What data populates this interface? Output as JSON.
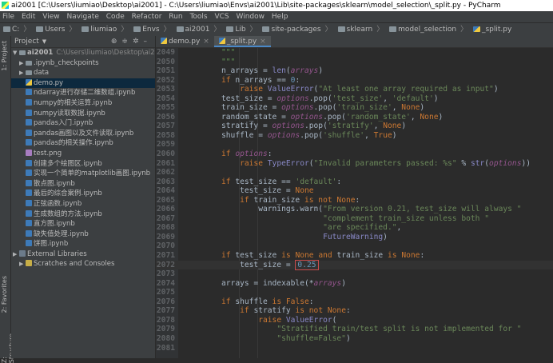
{
  "window": {
    "title": "ai2001 [C:\\Users\\liumiao\\Desktop\\ai2001] - C:\\Users\\liumiao\\Envs\\ai2001\\Lib\\site-packages\\sklearn\\model_selection\\_split.py - PyCharm"
  },
  "menu": [
    "File",
    "Edit",
    "View",
    "Navigate",
    "Code",
    "Refactor",
    "Run",
    "Tools",
    "VCS",
    "Window",
    "Help"
  ],
  "breadcrumbs": [
    "C:",
    "Users",
    "liumiao",
    "Envs",
    "ai2001",
    "Lib",
    "site-packages",
    "sklearn",
    "model_selection",
    "_split.py"
  ],
  "left_tools": {
    "project": "1: Project",
    "favorites": "2: Favorites",
    "structure": "Z: Structure"
  },
  "project_panel": {
    "title": "Project",
    "root": {
      "name": "ai2001",
      "path": "C:\\Users\\liumiao\\Desktop\\ai2001"
    },
    "items": [
      {
        "name": ".ipynb_checkpoints",
        "type": "folder"
      },
      {
        "name": "data",
        "type": "folder"
      },
      {
        "name": "demo.py",
        "type": "py",
        "selected": true
      },
      {
        "name": "ndarray进行存储二维数组.ipynb",
        "type": "nb"
      },
      {
        "name": "numpy的相关运算.ipynb",
        "type": "nb"
      },
      {
        "name": "numpy读取数据.ipynb",
        "type": "nb"
      },
      {
        "name": "pandas入门.ipynb",
        "type": "nb"
      },
      {
        "name": "pandas画图以及文件读取.ipynb",
        "type": "nb"
      },
      {
        "name": "pandas的相关操作.ipynb",
        "type": "nb"
      },
      {
        "name": "test.png",
        "type": "png"
      },
      {
        "name": "创建多个绘图区.ipynb",
        "type": "nb"
      },
      {
        "name": "实现一个简单的matplotlib画图.ipynb",
        "type": "nb"
      },
      {
        "name": "散点图.ipynb",
        "type": "nb"
      },
      {
        "name": "最后的综合案例.ipynb",
        "type": "nb"
      },
      {
        "name": "正弦函数.ipynb",
        "type": "nb"
      },
      {
        "name": "生成数组的方法.ipynb",
        "type": "nb"
      },
      {
        "name": "直方图.ipynb",
        "type": "nb"
      },
      {
        "name": "缺失值处理.ipynb",
        "type": "nb"
      },
      {
        "name": "饼图.ipynb",
        "type": "nb"
      }
    ],
    "external": "External Libraries",
    "scratches": "Scratches and Consoles"
  },
  "tabs": [
    {
      "label": "demo.py",
      "active": false
    },
    {
      "label": "_split.py",
      "active": true
    }
  ],
  "editor": {
    "lines": [
      {
        "n": "2049",
        "html": "<span class=\"cmt\">\"\"\"</span>",
        "cur": false
      },
      {
        "n": "2050",
        "html": "<span class=\"cmt\">\"\"\"</span>",
        "cur": false
      },
      {
        "n": "2051",
        "html": "n_arrays = <span class=\"bi\">len</span>(<span class=\"it\">arrays</span>)",
        "cur": false
      },
      {
        "n": "2052",
        "html": "<span class=\"kw\">if</span> n_arrays == <span class=\"nm\">0</span>:",
        "cur": false
      },
      {
        "n": "2053",
        "html": "    <span class=\"kw\">raise</span> <span class=\"bi\">ValueError</span>(<span class=\"st\">\"At least one array required as input\"</span>)",
        "cur": false
      },
      {
        "n": "2054",
        "html": "test_size = <span class=\"it\">options</span>.pop(<span class=\"st\">'test_size'</span>, <span class=\"st\">'default'</span>)",
        "cur": false
      },
      {
        "n": "2055",
        "html": "train_size = <span class=\"it\">options</span>.pop(<span class=\"st\">'train_size'</span>, <span class=\"kw\">None</span>)",
        "cur": false
      },
      {
        "n": "2056",
        "html": "random_state = <span class=\"it\">options</span>.pop(<span class=\"st\">'random_state'</span>, <span class=\"kw\">None</span>)",
        "cur": false
      },
      {
        "n": "2057",
        "html": "stratify = <span class=\"it\">options</span>.pop(<span class=\"st\">'stratify'</span>, <span class=\"kw\">None</span>)",
        "cur": false
      },
      {
        "n": "2058",
        "html": "shuffle = <span class=\"it\">options</span>.pop(<span class=\"st\">'shuffle'</span>, <span class=\"kw\">True</span>)",
        "cur": false
      },
      {
        "n": "2059",
        "html": "",
        "cur": false
      },
      {
        "n": "2060",
        "html": "<span class=\"kw\">if</span> <span class=\"it\">options</span>:",
        "cur": false
      },
      {
        "n": "2061",
        "html": "    <span class=\"kw\">raise</span> <span class=\"bi\">TypeError</span>(<span class=\"st\">\"Invalid parameters passed: %s\"</span> % <span class=\"bi\">str</span>(<span class=\"it\">options</span>))",
        "cur": false
      },
      {
        "n": "2062",
        "html": "",
        "cur": false
      },
      {
        "n": "2063",
        "html": "<span class=\"kw\">if</span> test_size == <span class=\"st\">'default'</span>:",
        "cur": false
      },
      {
        "n": "2064",
        "html": "    test_size = <span class=\"kw\">None</span>",
        "cur": false
      },
      {
        "n": "2065",
        "html": "    <span class=\"kw\">if</span> train_size <span class=\"kw\">is not</span> <span class=\"kw\">None</span>:",
        "cur": false
      },
      {
        "n": "2066",
        "html": "        warnings.warn(<span class=\"st\">\"From version 0.21, test_size will always \"</span>",
        "cur": false
      },
      {
        "n": "2067",
        "html": "                      <span class=\"st\">\"complement train_size unless both \"</span>",
        "cur": false
      },
      {
        "n": "2068",
        "html": "                      <span class=\"st\">\"are specified.\"</span>,",
        "cur": false
      },
      {
        "n": "2069",
        "html": "                      <span class=\"bi\">FutureWarning</span>)",
        "cur": false
      },
      {
        "n": "2070",
        "html": "",
        "cur": false
      },
      {
        "n": "2071",
        "html": "<span class=\"kw\">if</span> test_size <span class=\"kw\">is</span> <span class=\"kw\">None</span> <span class=\"kw\">and</span> train_size <span class=\"kw\">is</span> <span class=\"kw\">None</span>:",
        "cur": false
      },
      {
        "n": "2072",
        "html": "    test_size = <span class=\"selbox\"><span class=\"nm\">0.25</span></span>",
        "cur": true
      },
      {
        "n": "2073",
        "html": "",
        "cur": false
      },
      {
        "n": "2074",
        "html": "arrays = indexable(*<span class=\"it\">arrays</span>)",
        "cur": false
      },
      {
        "n": "2075",
        "html": "",
        "cur": false
      },
      {
        "n": "2076",
        "html": "<span class=\"kw\">if</span> shuffle <span class=\"kw\">is</span> <span class=\"kw\">False</span>:",
        "cur": false
      },
      {
        "n": "2077",
        "html": "    <span class=\"kw\">if</span> stratify <span class=\"kw\">is not</span> <span class=\"kw\">None</span>:",
        "cur": false
      },
      {
        "n": "2078",
        "html": "        <span class=\"kw\">raise</span> <span class=\"bi\">ValueError</span>(",
        "cur": false
      },
      {
        "n": "2079",
        "html": "            <span class=\"st\">\"Stratified train/test split is not implemented for \"</span>",
        "cur": false
      },
      {
        "n": "2080",
        "html": "            <span class=\"st\">\"shuffle=False\"</span>)",
        "cur": false
      },
      {
        "n": "2081",
        "html": "",
        "cur": false
      }
    ]
  }
}
